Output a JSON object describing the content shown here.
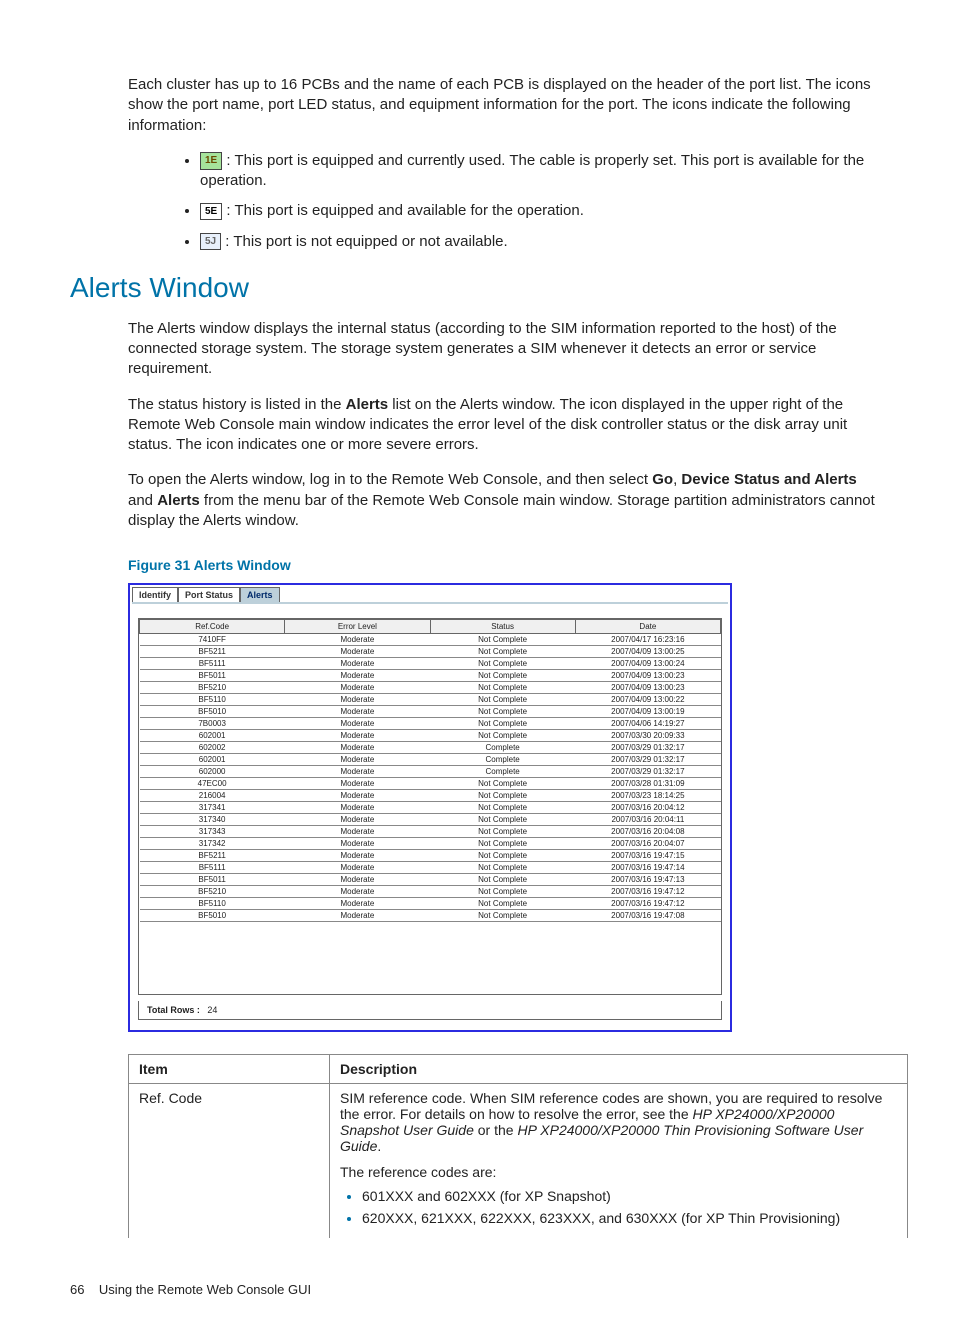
{
  "intro": "Each cluster has up to 16 PCBs and the name of each PCB is displayed on the header of the port list. The icons show the port name, port LED status, and equipment information for the port. The icons indicate the following information:",
  "port_icons": [
    {
      "label": "1E",
      "text": ": This port is equipped and currently used. The cable is properly set. This port is available for the operation."
    },
    {
      "label": "5E",
      "text": ": This port is equipped and available for the operation."
    },
    {
      "label": "5J",
      "text": ": This port is not equipped or not available."
    }
  ],
  "heading": "Alerts Window",
  "para1": "The Alerts window displays the internal status (according to the SIM information reported to the host) of the connected storage system. The storage system generates a SIM whenever it detects an error or service requirement.",
  "para2_a": "The status history is listed in the ",
  "para2_b": "Alerts",
  "para2_c": " list on the Alerts window. The icon displayed in the upper right of the Remote Web Console main window indicates the error level of the disk controller status or the disk array unit status. The icon indicates one or more severe errors.",
  "para3_a": "To open the Alerts window, log in to the Remote Web Console, and then select ",
  "para3_go": "Go",
  "para3_b": ", ",
  "para3_dsa": "Device Status and Alerts",
  "para3_c": " and ",
  "para3_alerts": "Alerts",
  "para3_d": " from the menu bar of the Remote Web Console main window. Storage partition administrators cannot display the Alerts window.",
  "figure_caption": "Figure 31 Alerts Window",
  "tabs": [
    "Identify",
    "Port Status",
    "Alerts"
  ],
  "grid_headers": [
    "Ref.Code",
    "Error Level",
    "Status",
    "Date"
  ],
  "grid_rows": [
    [
      "7410FF",
      "Moderate",
      "Not Complete",
      "2007/04/17 16:23:16"
    ],
    [
      "BF5211",
      "Moderate",
      "Not Complete",
      "2007/04/09 13:00:25"
    ],
    [
      "BF5111",
      "Moderate",
      "Not Complete",
      "2007/04/09 13:00:24"
    ],
    [
      "BF5011",
      "Moderate",
      "Not Complete",
      "2007/04/09 13:00:23"
    ],
    [
      "BF5210",
      "Moderate",
      "Not Complete",
      "2007/04/09 13:00:23"
    ],
    [
      "BF5110",
      "Moderate",
      "Not Complete",
      "2007/04/09 13:00:22"
    ],
    [
      "BF5010",
      "Moderate",
      "Not Complete",
      "2007/04/09 13:00:19"
    ],
    [
      "7B0003",
      "Moderate",
      "Not Complete",
      "2007/04/06 14:19:27"
    ],
    [
      "602001",
      "Moderate",
      "Not Complete",
      "2007/03/30 20:09:33"
    ],
    [
      "602002",
      "Moderate",
      "Complete",
      "2007/03/29 01:32:17"
    ],
    [
      "602001",
      "Moderate",
      "Complete",
      "2007/03/29 01:32:17"
    ],
    [
      "602000",
      "Moderate",
      "Complete",
      "2007/03/29 01:32:17"
    ],
    [
      "47EC00",
      "Moderate",
      "Not Complete",
      "2007/03/28 01:31:09"
    ],
    [
      "216004",
      "Moderate",
      "Not Complete",
      "2007/03/23 18:14:25"
    ],
    [
      "317341",
      "Moderate",
      "Not Complete",
      "2007/03/16 20:04:12"
    ],
    [
      "317340",
      "Moderate",
      "Not Complete",
      "2007/03/16 20:04:11"
    ],
    [
      "317343",
      "Moderate",
      "Not Complete",
      "2007/03/16 20:04:08"
    ],
    [
      "317342",
      "Moderate",
      "Not Complete",
      "2007/03/16 20:04:07"
    ],
    [
      "BF5211",
      "Moderate",
      "Not Complete",
      "2007/03/16 19:47:15"
    ],
    [
      "BF5111",
      "Moderate",
      "Not Complete",
      "2007/03/16 19:47:14"
    ],
    [
      "BF5011",
      "Moderate",
      "Not Complete",
      "2007/03/16 19:47:13"
    ],
    [
      "BF5210",
      "Moderate",
      "Not Complete",
      "2007/03/16 19:47:12"
    ],
    [
      "BF5110",
      "Moderate",
      "Not Complete",
      "2007/03/16 19:47:12"
    ],
    [
      "BF5010",
      "Moderate",
      "Not Complete",
      "2007/03/16 19:47:08"
    ]
  ],
  "total_label": "Total Rows :",
  "total_value": "24",
  "desc_headers": [
    "Item",
    "Description"
  ],
  "desc_item": "Ref. Code",
  "desc_text_a": "SIM reference code. When SIM reference codes are shown, you are required to resolve the error. For details on how to resolve the error, see the ",
  "desc_doc1": "HP XP24000/XP20000 Snapshot User Guide",
  "desc_text_b": " or the ",
  "desc_doc2": "HP XP24000/XP20000 Thin Provisioning Software User Guide",
  "desc_text_c": ".",
  "desc_ref_intro": "The reference codes are:",
  "desc_ref_items": [
    "601XXX and 602XXX (for XP Snapshot)",
    "620XXX, 621XXX, 622XXX, 623XXX, and 630XXX (for XP Thin Provisioning)"
  ],
  "footer_page": "66",
  "footer_text": "Using the Remote Web Console GUI"
}
